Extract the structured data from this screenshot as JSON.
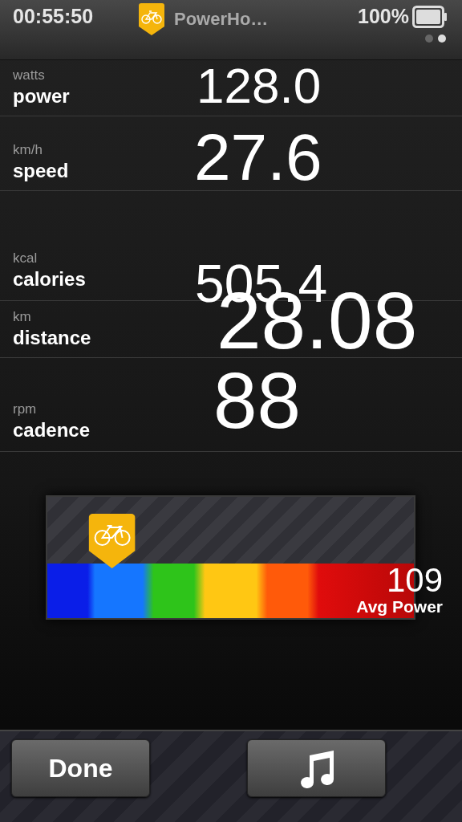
{
  "status_bar": {
    "time": "00:55:50",
    "app_title": "PowerHo…",
    "battery": "100%"
  },
  "page_dots": [
    {
      "selected": false
    },
    {
      "selected": true
    }
  ],
  "metrics": [
    {
      "unit": "watts",
      "name": "power",
      "value": "128.0"
    },
    {
      "unit": "km/h",
      "name": "speed",
      "value": "27.6"
    },
    {
      "unit": "kcal",
      "name": "calories",
      "value": "505.4"
    },
    {
      "unit": "km",
      "name": "distance",
      "value": "28.08"
    },
    {
      "unit": "rpm",
      "name": "cadence",
      "value": "88"
    }
  ],
  "power_gauge": {
    "level": 0.15,
    "avg_value": "109",
    "avg_label": "Avg Power"
  },
  "buttons": [
    {
      "kind": "text",
      "label": "Done"
    },
    {
      "kind": "music"
    }
  ]
}
